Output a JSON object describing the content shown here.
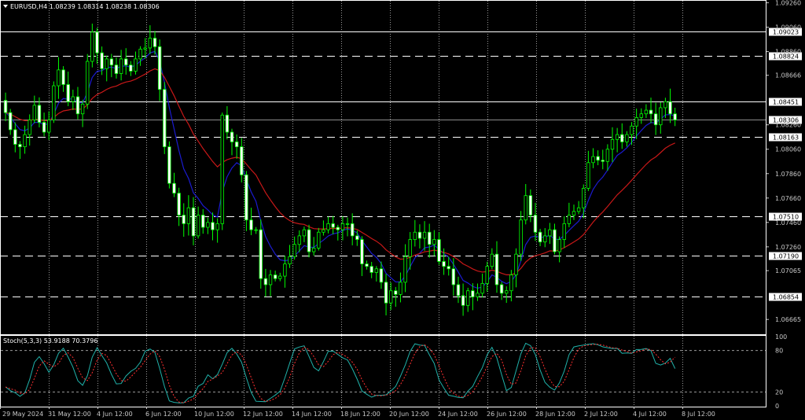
{
  "header": {
    "symbol_line": "EURUSD,H4  1.08239 1.08314 1.08238 1.08306",
    "collapse_icon": "triangle-down-icon"
  },
  "colors": {
    "background": "#000000",
    "candle": "#00ff00",
    "candle_body_up": "#000000",
    "candle_body_down": "#ffffff",
    "ma_fast": "#1b1bd0",
    "ma_slow": "#c81818",
    "stoch_main": "#20b2aa",
    "stoch_signal": "#ff3030",
    "grid": "#9a9a9a",
    "level_solid": "#ffffff",
    "level_dashed": "#ffffff"
  },
  "price_axis": {
    "ticks": [
      "1.09260",
      "1.09060",
      "1.08860",
      "1.08666",
      "1.08260",
      "1.08060",
      "1.07860",
      "1.07660",
      "1.07460",
      "1.07260",
      "1.07065",
      "1.06665"
    ]
  },
  "time_axis": {
    "labels": [
      "29 May 2024",
      "31 May 12:00",
      "4 Jun 12:00",
      "6 Jun 12:00",
      "10 Jun 12:00",
      "12 Jun 12:00",
      "14 Jun 12:00",
      "18 Jun 12:00",
      "20 Jun 12:00",
      "24 Jun 12:00",
      "26 Jun 12:00",
      "28 Jun 12:00",
      "2 Jul 12:00",
      "4 Jul 12:00",
      "8 Jul 12:00"
    ]
  },
  "levels": [
    {
      "price": "1.09023",
      "style": "solid"
    },
    {
      "price": "1.08824",
      "style": "dashed"
    },
    {
      "price": "1.08451",
      "style": "solid"
    },
    {
      "price": "1.08306",
      "style": "current"
    },
    {
      "price": "1.08163",
      "style": "dashed"
    },
    {
      "price": "1.07510",
      "style": "dashed"
    },
    {
      "price": "1.07190",
      "style": "dashed"
    },
    {
      "price": "1.06854",
      "style": "dashed"
    }
  ],
  "stoch": {
    "label": "Stoch(5,3,3) 53.9188 70.3796",
    "ticks": [
      "100",
      "80",
      "20",
      "0"
    ]
  },
  "chart_data": {
    "type": "candlestick",
    "symbol": "EURUSD",
    "timeframe": "H4",
    "ylim": [
      1.0655,
      1.0927
    ],
    "closes": [
      1.0836,
      1.0822,
      1.081,
      1.0808,
      1.0818,
      1.083,
      1.0842,
      1.0828,
      1.082,
      1.083,
      1.0858,
      1.0871,
      1.0859,
      1.0845,
      1.0849,
      1.0835,
      1.0843,
      1.0878,
      1.0902,
      1.0885,
      1.0872,
      1.088,
      1.0875,
      1.0868,
      1.088,
      1.0875,
      1.087,
      1.088,
      1.0888,
      1.0889,
      1.0897,
      1.089,
      1.0855,
      1.0808,
      1.0778,
      1.077,
      1.0752,
      1.0745,
      1.0758,
      1.0735,
      1.0752,
      1.0742,
      1.0746,
      1.074,
      1.0745,
      1.0834,
      1.082,
      1.0812,
      1.0808,
      1.0785,
      1.0748,
      1.074,
      1.074,
      1.07,
      1.0695,
      1.0703,
      1.07,
      1.0702,
      1.0712,
      1.0718,
      1.0728,
      1.0735,
      1.074,
      1.0722,
      1.0725,
      1.0738,
      1.074,
      1.0745,
      1.0742,
      1.074,
      1.0745,
      1.0745,
      1.0735,
      1.0732,
      1.0712,
      1.071,
      1.0705,
      1.0708,
      1.0697,
      1.068,
      1.069,
      1.0687,
      1.0697,
      1.0718,
      1.0732,
      1.0738,
      1.0733,
      1.0738,
      1.0728,
      1.0732,
      1.0714,
      1.071,
      1.0708,
      1.0695,
      1.0686,
      1.0678,
      1.069,
      1.0685,
      1.0688,
      1.0696,
      1.071,
      1.072,
      1.0695,
      1.0688,
      1.069,
      1.0703,
      1.072,
      1.0748,
      1.0768,
      1.0752,
      1.0738,
      1.073,
      1.0735,
      1.074,
      1.0722,
      1.0732,
      1.0745,
      1.0752,
      1.0755,
      1.0758,
      1.0774,
      1.0795,
      1.08,
      1.0797,
      1.0796,
      1.0806,
      1.0814,
      1.0818,
      1.0812,
      1.0818,
      1.0825,
      1.0832,
      1.0835,
      1.0838,
      1.0835,
      1.0826,
      1.084,
      1.0845,
      1.0835,
      1.083
    ],
    "indicators": [
      {
        "name": "MA fast",
        "color": "#1b1bd0"
      },
      {
        "name": "MA slow",
        "color": "#c81818"
      }
    ],
    "stochastic": {
      "params": "5,3,3",
      "main": 53.9188,
      "signal": 70.3796,
      "levels": [
        20,
        80
      ],
      "ylim": [
        0,
        100
      ]
    }
  }
}
